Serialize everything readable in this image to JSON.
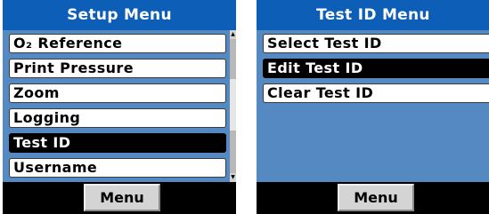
{
  "setup_menu": {
    "title": "Setup Menu",
    "items": [
      {
        "label": "O₂ Reference",
        "selected": false
      },
      {
        "label": "Print Pressure",
        "selected": false
      },
      {
        "label": "Zoom",
        "selected": false
      },
      {
        "label": "Logging",
        "selected": false
      },
      {
        "label": "Test ID",
        "selected": true
      },
      {
        "label": "Username",
        "selected": false
      }
    ],
    "scroll_up_icon": "triangle-up",
    "scroll_down_icon": "triangle-down",
    "softkey_label": "Menu"
  },
  "test_id_menu": {
    "title": "Test ID Menu",
    "items": [
      {
        "label": "Select Test ID",
        "selected": false
      },
      {
        "label": "Edit Test ID",
        "selected": true
      },
      {
        "label": "Clear Test ID",
        "selected": false
      }
    ],
    "softkey_label": "Menu"
  },
  "colors": {
    "title_bar": "#0c5eb6",
    "list_background": "#5589c2",
    "selected_item": "#000000",
    "softkey_bar": "#000000",
    "softkey_button": "#d4d4d4"
  }
}
